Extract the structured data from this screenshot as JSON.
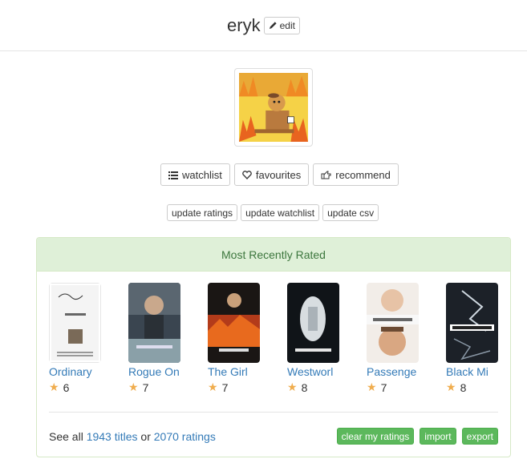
{
  "header": {
    "username": "eryk",
    "edit_label": "edit",
    "edit_icon": "pencil-icon"
  },
  "profile_nav": [
    {
      "label": "watchlist",
      "icon": "list-icon"
    },
    {
      "label": "favourites",
      "icon": "heart-icon"
    },
    {
      "label": "recommend",
      "icon": "hand-pointing-icon"
    }
  ],
  "update_buttons": [
    "update ratings",
    "update watchlist",
    "update csv"
  ],
  "recent": {
    "heading": "Most Recently Rated",
    "movies": [
      {
        "title": "Ordinary",
        "rating": "6"
      },
      {
        "title": "Rogue On",
        "rating": "7"
      },
      {
        "title": "The Girl",
        "rating": "7"
      },
      {
        "title": "Westworl",
        "rating": "8"
      },
      {
        "title": "Passenge",
        "rating": "7"
      },
      {
        "title": "Black Mi",
        "rating": "8"
      }
    ],
    "footer": {
      "see_all": "See all",
      "titles_link": "1943 titles",
      "or": "or",
      "ratings_link": "2070 ratings"
    },
    "actions": [
      "clear my ratings",
      "import",
      "export"
    ]
  },
  "colors": {
    "link": "#337ab7",
    "success": "#5cb85c",
    "panel_heading_bg": "#dff0d8",
    "star": "#f0ad4e"
  }
}
